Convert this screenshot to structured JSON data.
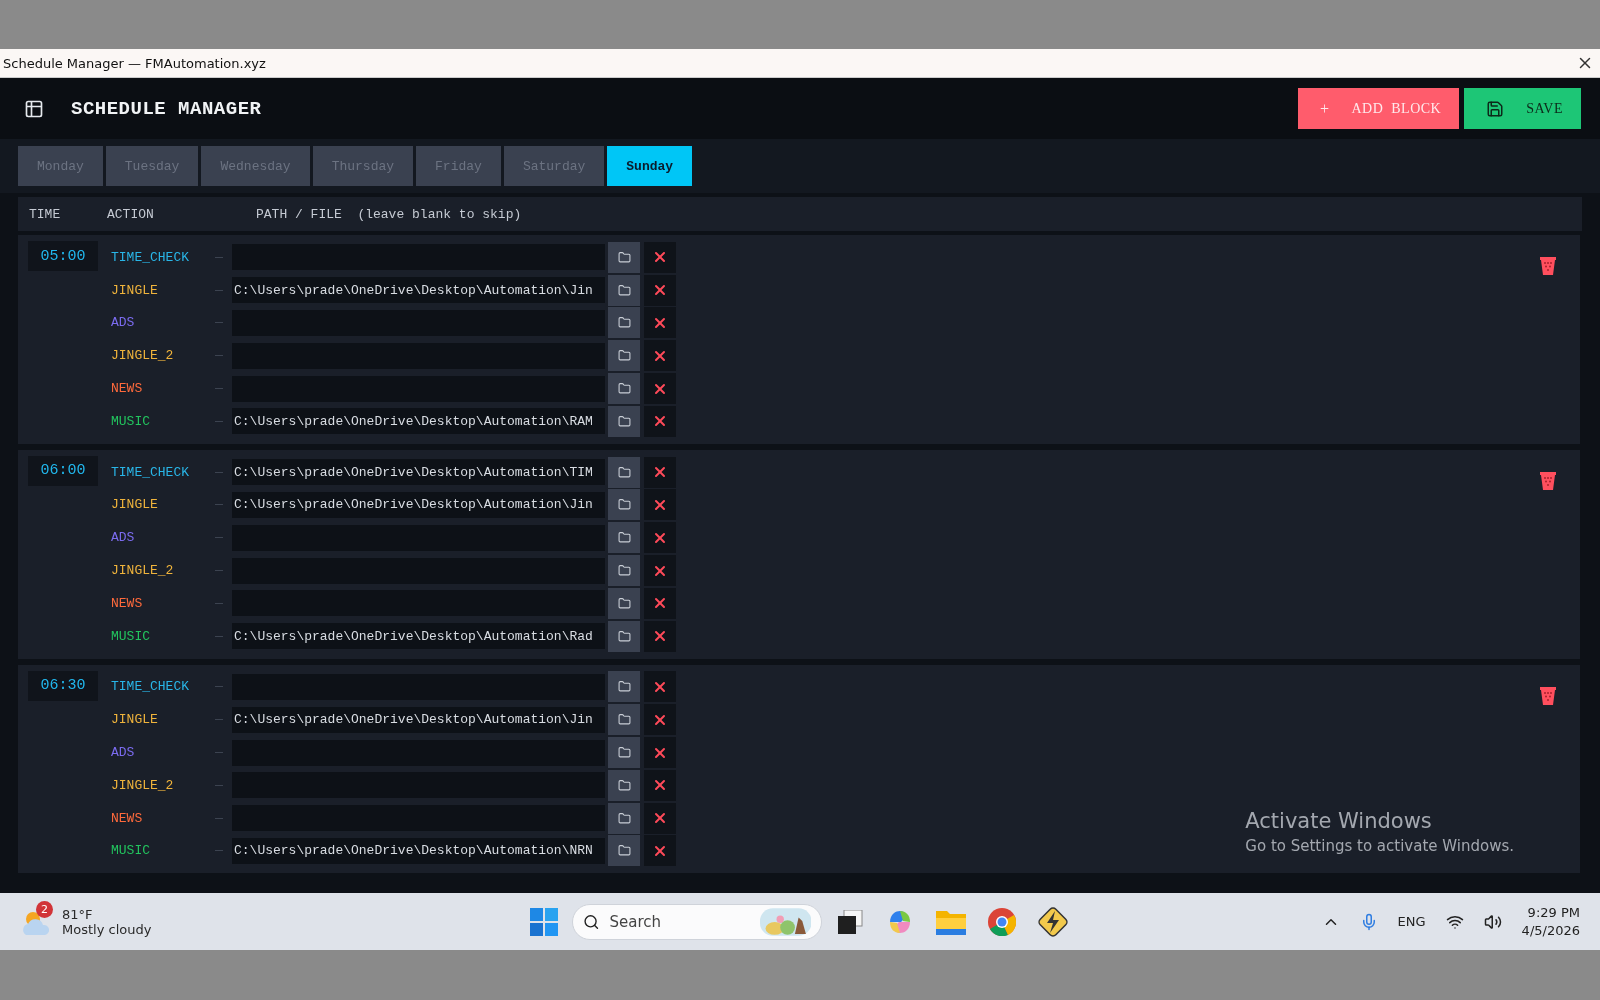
{
  "window": {
    "title": "Schedule Manager — FMAutomation.xyz"
  },
  "header": {
    "title": "SCHEDULE MANAGER",
    "buttons": [
      {
        "kind": "add",
        "icon": "+",
        "label": "ADD BLOCK"
      },
      {
        "kind": "save",
        "label": "SAVE"
      }
    ]
  },
  "tabs": [
    {
      "label": "Monday",
      "selected": false
    },
    {
      "label": "Tuesday",
      "selected": false
    },
    {
      "label": "Wednesday",
      "selected": false
    },
    {
      "label": "Thursday",
      "selected": false
    },
    {
      "label": "Friday",
      "selected": false
    },
    {
      "label": "Saturday",
      "selected": false
    },
    {
      "label": "Sunday",
      "selected": true
    }
  ],
  "columns": [
    "TIME",
    "ACTION",
    "PATH / FILE  (leave blank to skip)"
  ],
  "blocks": [
    {
      "time": "05:00",
      "rows": [
        {
          "action": "TIME_CHECK",
          "color": "#29b6e8"
        },
        {
          "action": "JINGLE",
          "color": "#f0b43c",
          "path": "C:\\Users\\prade\\OneDrive\\Desktop\\Automation\\Jin"
        },
        {
          "action": "ADS",
          "color": "#7c6cf0"
        },
        {
          "action": "JINGLE_2",
          "color": "#f0b43c"
        },
        {
          "action": "NEWS",
          "color": "#ff6a3c"
        },
        {
          "action": "MUSIC",
          "color": "#22c55e",
          "path": "C:\\Users\\prade\\OneDrive\\Desktop\\Automation\\RAM"
        }
      ]
    },
    {
      "time": "06:00",
      "rows": [
        {
          "action": "TIME_CHECK",
          "color": "#29b6e8",
          "path": "C:\\Users\\prade\\OneDrive\\Desktop\\Automation\\TIM"
        },
        {
          "action": "JINGLE",
          "color": "#f0b43c",
          "path": "C:\\Users\\prade\\OneDrive\\Desktop\\Automation\\Jin"
        },
        {
          "action": "ADS",
          "color": "#7c6cf0"
        },
        {
          "action": "JINGLE_2",
          "color": "#f0b43c"
        },
        {
          "action": "NEWS",
          "color": "#ff6a3c"
        },
        {
          "action": "MUSIC",
          "color": "#22c55e",
          "path": "C:\\Users\\prade\\OneDrive\\Desktop\\Automation\\Rad"
        }
      ]
    },
    {
      "time": "06:30",
      "rows": [
        {
          "action": "TIME_CHECK",
          "color": "#29b6e8"
        },
        {
          "action": "JINGLE",
          "color": "#f0b43c",
          "path": "C:\\Users\\prade\\OneDrive\\Desktop\\Automation\\Jin"
        },
        {
          "action": "ADS",
          "color": "#7c6cf0"
        },
        {
          "action": "JINGLE_2",
          "color": "#f0b43c"
        },
        {
          "action": "NEWS",
          "color": "#ff6a3c"
        },
        {
          "action": "MUSIC",
          "color": "#22c55e",
          "path": "C:\\Users\\prade\\OneDrive\\Desktop\\Automation\\NRN"
        }
      ]
    }
  ],
  "activation_notice": {
    "title": "Activate Windows",
    "text": "Go to Settings to activate Windows."
  },
  "taskbar": {
    "weather": {
      "badge": "2",
      "temperature": "81°F",
      "condition": "Mostly cloudy"
    },
    "search": {
      "placeholder": "Search"
    },
    "tray": {
      "language": "ENG",
      "time": "9:29 PM",
      "date": "4/5/2026"
    }
  }
}
